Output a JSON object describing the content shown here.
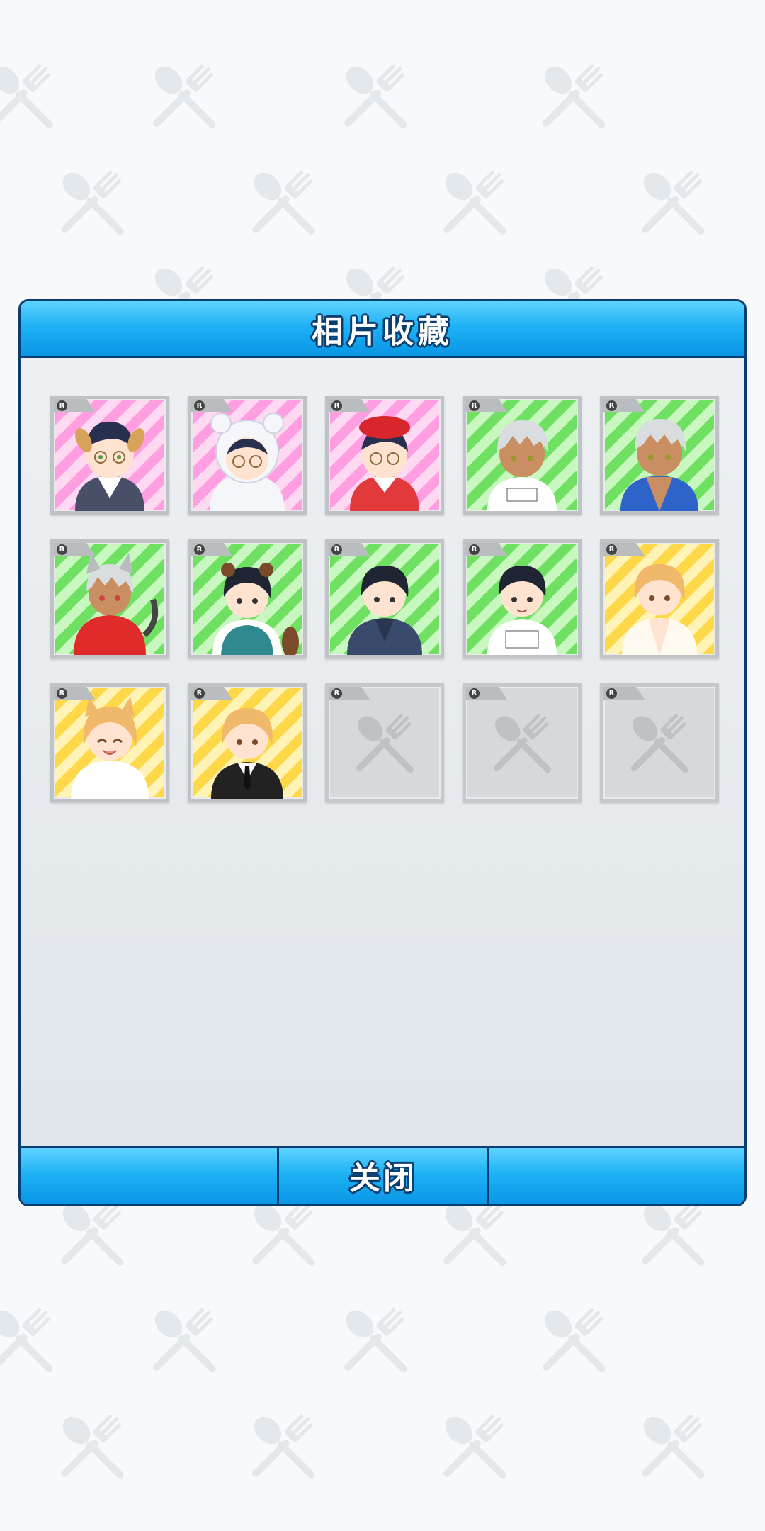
{
  "screen": {
    "title": "相片收藏",
    "close_label": "关闭"
  },
  "colors": {
    "accent": "#1eb2f4",
    "border": "#0a3d70",
    "pink": "#ff9ee0",
    "green": "#6fe062",
    "yellow": "#ffd84a"
  },
  "photos": [
    {
      "rarity": "R",
      "theme": "pink",
      "unlocked": true,
      "character": "glasses boy with dog ears in waiter vest"
    },
    {
      "rarity": "R",
      "theme": "pink",
      "unlocked": true,
      "character": "glasses boy in white bear hood"
    },
    {
      "rarity": "R",
      "theme": "pink",
      "unlocked": true,
      "character": "glasses boy with red beret and apron"
    },
    {
      "rarity": "R",
      "theme": "green",
      "unlocked": true,
      "character": "silver-haired boy in gym shirt"
    },
    {
      "rarity": "R",
      "theme": "green",
      "unlocked": true,
      "character": "silver-haired boy in blue happi"
    },
    {
      "rarity": "R",
      "theme": "green",
      "unlocked": true,
      "character": "silver-haired boy with cat ears in red hoodie"
    },
    {
      "rarity": "R",
      "theme": "green",
      "unlocked": true,
      "character": "black-haired boy with raccoon ears in sweater vest"
    },
    {
      "rarity": "R",
      "theme": "green",
      "unlocked": true,
      "character": "black-haired boy in blue kimono"
    },
    {
      "rarity": "R",
      "theme": "green",
      "unlocked": true,
      "character": "black-haired boy in gym shirt"
    },
    {
      "rarity": "R",
      "theme": "yellow",
      "unlocked": true,
      "character": "blonde boy in open white hoodie"
    },
    {
      "rarity": "R",
      "theme": "yellow",
      "unlocked": true,
      "character": "blonde boy with cat ears smiling"
    },
    {
      "rarity": "R",
      "theme": "yellow",
      "unlocked": true,
      "character": "blonde boy in black suit"
    },
    {
      "rarity": "R",
      "theme": "empty",
      "unlocked": false,
      "character": "locked"
    },
    {
      "rarity": "R",
      "theme": "empty",
      "unlocked": false,
      "character": "locked"
    },
    {
      "rarity": "R",
      "theme": "empty",
      "unlocked": false,
      "character": "locked"
    }
  ]
}
